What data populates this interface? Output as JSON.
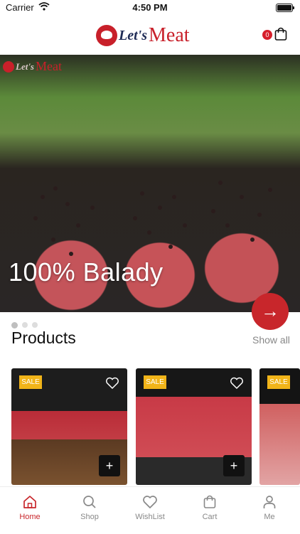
{
  "status_bar": {
    "carrier": "Carrier",
    "time": "4:50 PM"
  },
  "header": {
    "logo_lets": "Let's",
    "logo_meat": "Meat",
    "cart_count": "0"
  },
  "hero": {
    "logo_lets": "Let's",
    "logo_meat": "Meat",
    "title": "100% Balady",
    "arrow": "→",
    "slide_index": 0,
    "slide_count": 3
  },
  "products": {
    "title": "Products",
    "show_all": "Show all",
    "cards": [
      {
        "badge": "SALE",
        "add_label": "+"
      },
      {
        "badge": "SALE",
        "add_label": "+"
      },
      {
        "badge": "SALE"
      }
    ]
  },
  "tabbar": {
    "items": [
      {
        "label": "Home",
        "icon": "home-icon",
        "active": true
      },
      {
        "label": "Shop",
        "icon": "search-icon"
      },
      {
        "label": "WishList",
        "icon": "heart-icon"
      },
      {
        "label": "Cart",
        "icon": "bag-icon"
      },
      {
        "label": "Me",
        "icon": "user-icon"
      }
    ]
  },
  "colors": {
    "accent": "#c8262b",
    "sale": "#f1b419",
    "logo_navy": "#1e2b55"
  }
}
